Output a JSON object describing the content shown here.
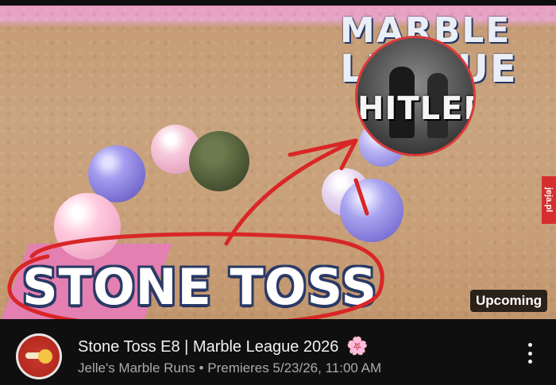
{
  "thumbnail": {
    "logo_line1": "MARBLE",
    "logo_line2": "LEAGUE",
    "inset_text": "HITLER",
    "big_title": "STONE TOSS",
    "badge": "Upcoming",
    "watermark": "jeja.pl",
    "annotation_color": "#d92626"
  },
  "video": {
    "title": "Stone Toss E8 | Marble League 2026",
    "title_emoji": "🌸",
    "channel": "Jelle's Marble Runs",
    "separator": "•",
    "schedule": "Premieres 5/23/26, 11:00 AM"
  },
  "icons": {
    "avatar": "channel-avatar",
    "menu": "more-vertical-icon"
  }
}
